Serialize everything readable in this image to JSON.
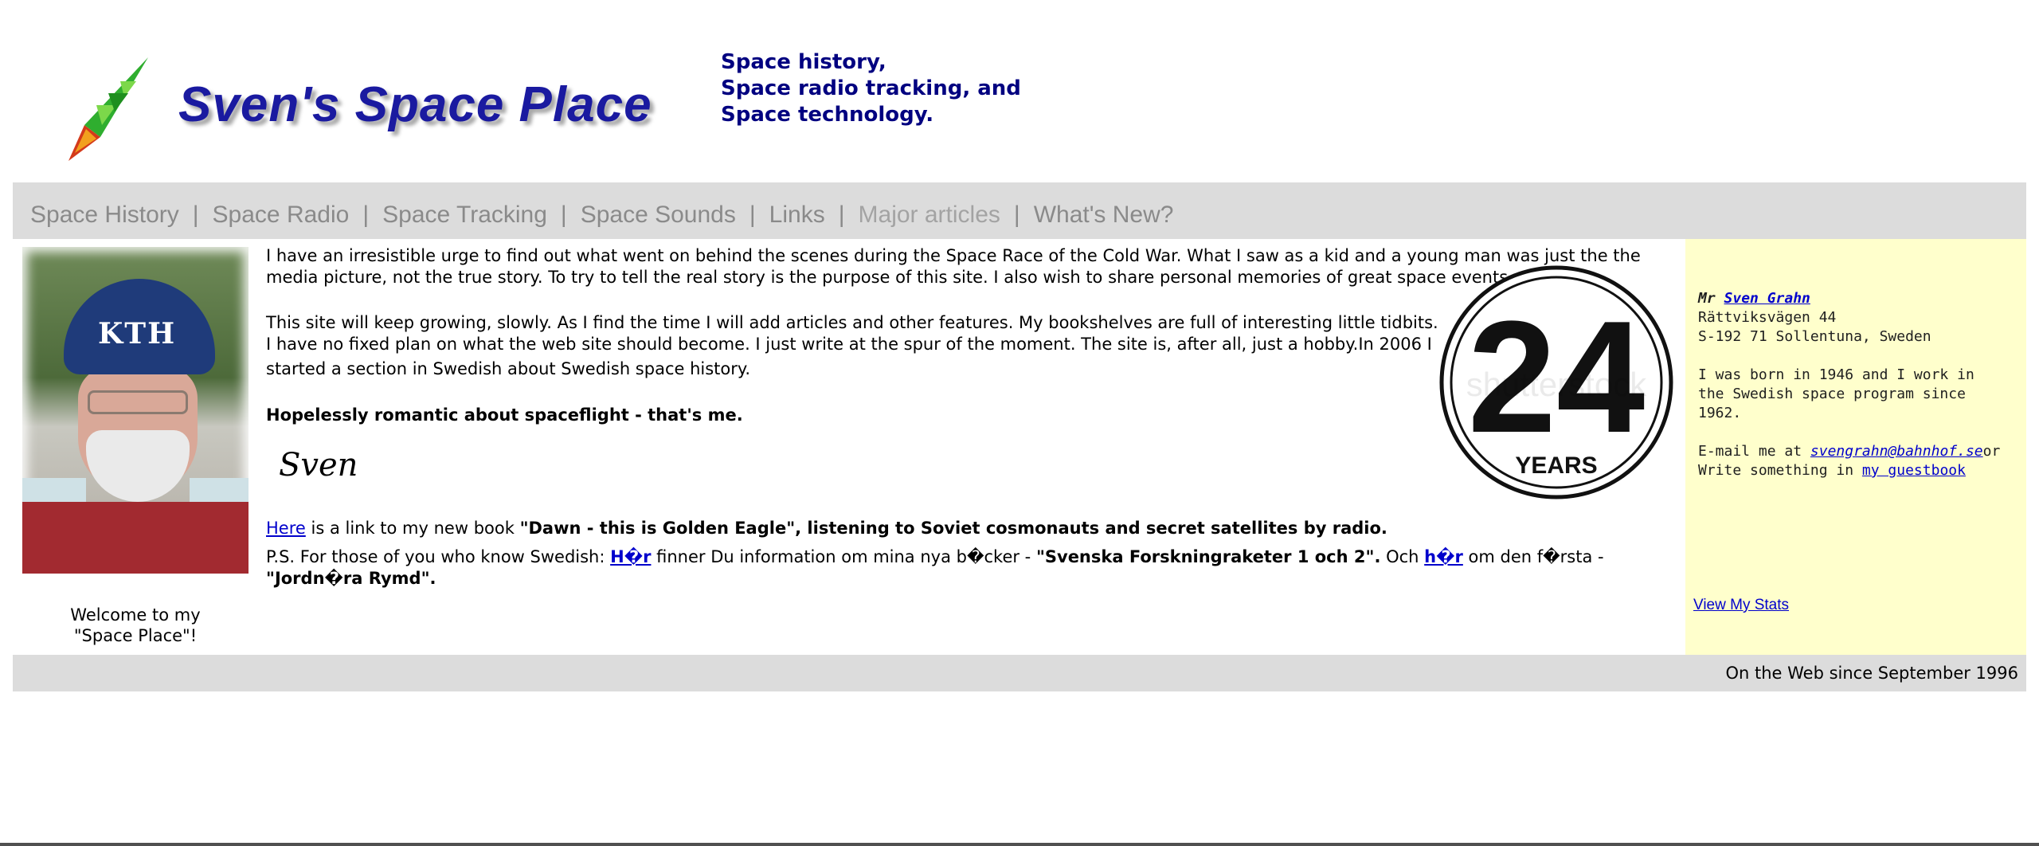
{
  "header": {
    "logo_text": "Sven's Space Place",
    "tagline": [
      "Space history,",
      "Space radio tracking, and",
      "Space technology."
    ]
  },
  "nav": {
    "items": [
      {
        "label": "Space History"
      },
      {
        "label": "Space Radio"
      },
      {
        "label": "Space Tracking"
      },
      {
        "label": "Space Sounds"
      },
      {
        "label": "Links"
      },
      {
        "label": "Major articles"
      },
      {
        "label": "What's New?"
      }
    ],
    "separator": "|"
  },
  "photo": {
    "cap_text": "KTH"
  },
  "welcome": [
    "Welcome to my",
    "\"Space Place\"!"
  ],
  "content": {
    "para1": "I have an irresistible urge to find out what went on behind the scenes during the Space Race of the Cold War. What I saw as a kid and a young man was just the the media picture, not the true story. To try to tell the real story is the purpose of this site. I also wish to share personal memories of great space events.",
    "para2": "This site will keep growing, slowly. As I find the time I will add articles and other features. My bookshelves are full of interesting little tidbits. I have no fixed plan on what the web site should become. I just write at the spur of the moment. The site is, after all, just a hobby.In 2006 I",
    "para2b": "started a section in Swedish about Swedish space history.",
    "romantic": "Hopelessly romantic about spaceflight - that's me.",
    "signature": "Sven",
    "book": {
      "link": "Here",
      "text": " is a link to my new book ",
      "title": "\"Dawn - this is Golden Eagle\", listening to Soviet cosmonauts and secret satellites by radio."
    },
    "ps": {
      "intro": "P.S. For those of you who know Swedish: ",
      "link1": "H�r",
      "mid1": " finner Du information om mina nya b�cker - ",
      "title1": "\"Svenska Forskningraketer 1 och 2\".",
      "mid2": "  Och ",
      "link2": "h�r",
      "mid3": " om den f�rsta - ",
      "title2": "\"Jordn�ra Rymd\"."
    }
  },
  "badge": {
    "number": "24",
    "label": "YEARS",
    "watermark": "shutterstock"
  },
  "sidebar": {
    "mr": "Mr ",
    "name": "Sven Grahn",
    "street": "Rättviksvägen 44",
    "city": "S-192 71 Sollentuna, Sweden",
    "bio": [
      "I was born in 1946 and I work in",
      "the Swedish space program since",
      "1962."
    ],
    "email_prefix": "E-mail me at ",
    "email": "svengrahn@bahnhof.se",
    "email_suffix": "or",
    "guestbook_prefix": "Write something in ",
    "guestbook": "my guestbook",
    "stats": "View My Stats"
  },
  "footer": {
    "text": "On the Web since September 1996"
  },
  "colors": {
    "nav_bg": "#dcdcdc",
    "sidebar_bg": "#ffffcc",
    "tagline": "#000080",
    "logo": "#1a1aa0",
    "link": "#0000cc"
  }
}
